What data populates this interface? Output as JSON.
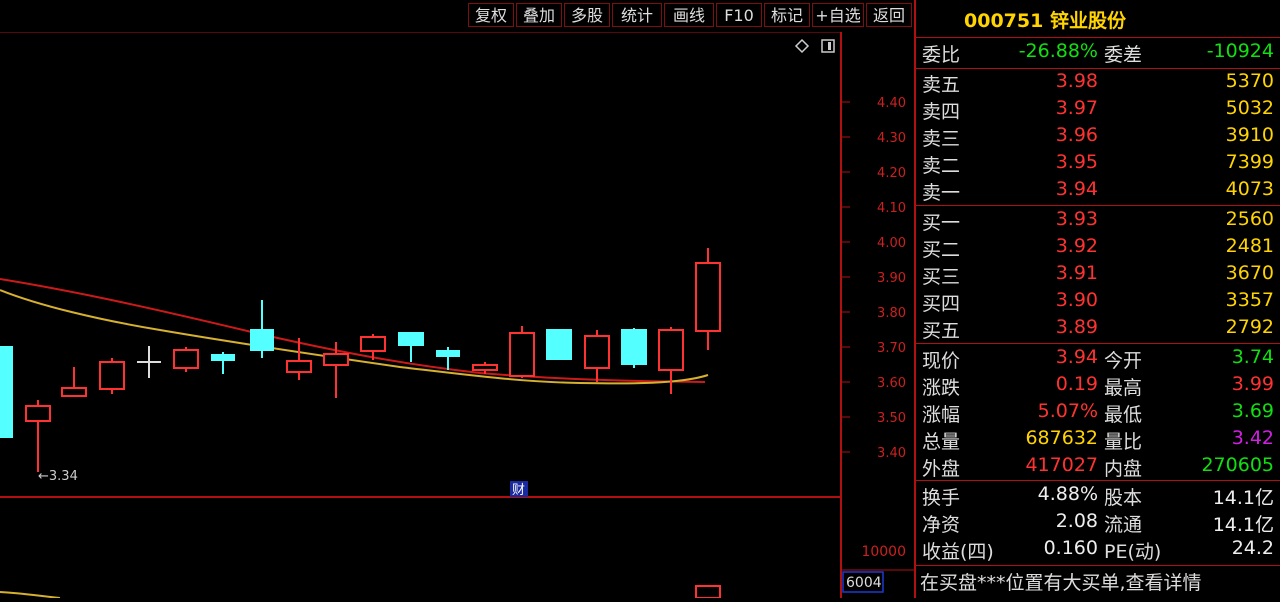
{
  "toolbar": {
    "buttons": [
      "复权",
      "叠加",
      "多股",
      "统计",
      "画线",
      "F10",
      "标记",
      "+自选",
      "返回"
    ]
  },
  "stock": {
    "code": "000751",
    "name": "锌业股份"
  },
  "entrust": {
    "ratio_label": "委比",
    "ratio_value": "-26.88%",
    "diff_label": "委差",
    "diff_value": "-10924"
  },
  "sell": [
    {
      "label": "卖五",
      "price": "3.98",
      "vol": "5370"
    },
    {
      "label": "卖四",
      "price": "3.97",
      "vol": "5032"
    },
    {
      "label": "卖三",
      "price": "3.96",
      "vol": "3910"
    },
    {
      "label": "卖二",
      "price": "3.95",
      "vol": "7399"
    },
    {
      "label": "卖一",
      "price": "3.94",
      "vol": "4073"
    }
  ],
  "buy": [
    {
      "label": "买一",
      "price": "3.93",
      "vol": "2560"
    },
    {
      "label": "买二",
      "price": "3.92",
      "vol": "2481"
    },
    {
      "label": "买三",
      "price": "3.91",
      "vol": "3670"
    },
    {
      "label": "买四",
      "price": "3.90",
      "vol": "3357"
    },
    {
      "label": "买五",
      "price": "3.89",
      "vol": "2792"
    }
  ],
  "quote": [
    {
      "l1": "现价",
      "v1": "3.94",
      "c1": "red",
      "l2": "今开",
      "v2": "3.74",
      "c2": "green"
    },
    {
      "l1": "涨跌",
      "v1": "0.19",
      "c1": "red",
      "l2": "最高",
      "v2": "3.99",
      "c2": "red"
    },
    {
      "l1": "涨幅",
      "v1": "5.07%",
      "c1": "red",
      "l2": "最低",
      "v2": "3.69",
      "c2": "green"
    },
    {
      "l1": "总量",
      "v1": "687632",
      "c1": "yellow",
      "l2": "量比",
      "v2": "3.42",
      "c2": "purple"
    },
    {
      "l1": "外盘",
      "v1": "417027",
      "c1": "red",
      "l2": "内盘",
      "v2": "270605",
      "c2": "green"
    }
  ],
  "fundamentals": [
    {
      "l1": "换手",
      "v1": "4.88%",
      "l2": "股本",
      "v2": "14.1亿"
    },
    {
      "l1": "净资",
      "v1": "2.08",
      "l2": "流通",
      "v2": "14.1亿"
    },
    {
      "l1": "收益(四)",
      "v1": "0.160",
      "l2": "PE(动)",
      "v2": "24.2"
    }
  ],
  "ticker": "在买盘***位置有大买单,查看详情",
  "chart": {
    "price_ticks": [
      "4.40",
      "4.30",
      "4.20",
      "4.10",
      "4.00",
      "3.90",
      "3.80",
      "3.70",
      "3.60",
      "3.50",
      "3.40"
    ],
    "low_marker": "3.34",
    "fin_marker": "财",
    "volume_tick": "10000",
    "volume_value": "6004"
  },
  "colors": {
    "up": "#ff3232",
    "down": "#54ffff",
    "ma1": "#cc1a1a",
    "ma2": "#d6b030",
    "border": "#b01010"
  }
}
